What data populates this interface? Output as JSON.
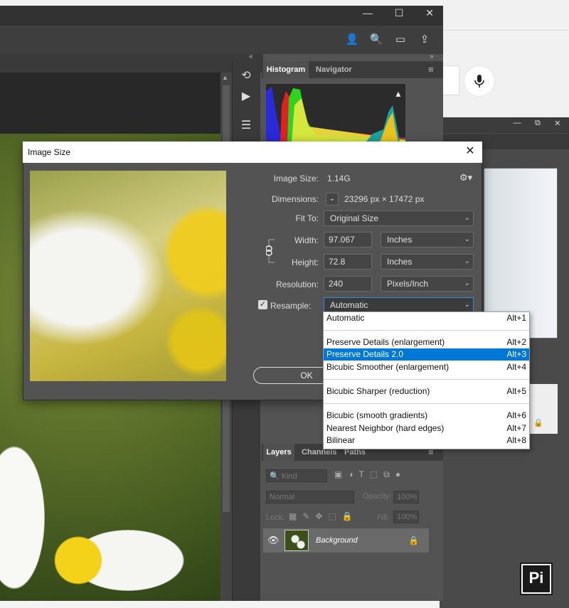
{
  "window": {
    "minimize": "—",
    "maximize": "☐",
    "close": "✕"
  },
  "panels": {
    "histogram_tab": "Histogram",
    "navigator_tab": "Navigator",
    "layers_tab": "Layers",
    "channels_tab": "Channels",
    "paths_tab": "Paths"
  },
  "layers": {
    "kind_placeholder": "Kind",
    "blend_mode": "Normal",
    "opacity_label": "Opacity:",
    "opacity_value": "100%",
    "lock_label": "Lock:",
    "fill_label": "Fill:",
    "fill_value": "100%",
    "layer_name": "Background"
  },
  "dialog": {
    "title": "Image Size",
    "image_size_label": "Image Size:",
    "image_size_value": "1.14G",
    "dimensions_label": "Dimensions:",
    "dimensions_value": "23296 px  ×  17472 px",
    "fit_to_label": "Fit To:",
    "fit_to_value": "Original Size",
    "width_label": "Width:",
    "width_value": "97.067",
    "width_unit": "Inches",
    "height_label": "Height:",
    "height_value": "72.8",
    "height_unit": "Inches",
    "resolution_label": "Resolution:",
    "resolution_value": "240",
    "resolution_unit": "Pixels/Inch",
    "resample_label": "Resample:",
    "resample_value": "Automatic",
    "resample_checked": true,
    "ok_label": "OK"
  },
  "resample_options": [
    {
      "label": "Automatic",
      "shortcut": "Alt+1"
    },
    {
      "label": "Preserve Details (enlargement)",
      "shortcut": "Alt+2"
    },
    {
      "label": "Preserve Details 2.0",
      "shortcut": "Alt+3",
      "selected": true
    },
    {
      "label": "Bicubic Smoother (enlargement)",
      "shortcut": "Alt+4"
    },
    {
      "label": "Bicubic Sharper (reduction)",
      "shortcut": "Alt+5"
    },
    {
      "label": "Bicubic (smooth gradients)",
      "shortcut": "Alt+6"
    },
    {
      "label": "Nearest Neighbor (hard edges)",
      "shortcut": "Alt+7"
    },
    {
      "label": "Bilinear",
      "shortcut": "Alt+8"
    }
  ],
  "colors": {
    "selection": "#0078d7",
    "panel": "#535353",
    "dark": "#323232"
  },
  "watermark": "Pi"
}
